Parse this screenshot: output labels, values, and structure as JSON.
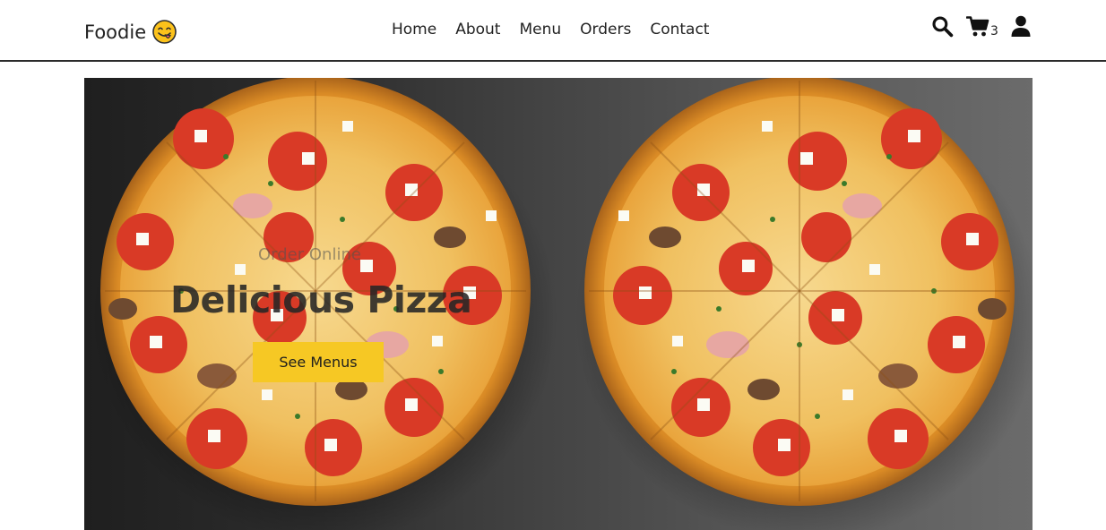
{
  "brand": {
    "name": "Foodie",
    "emoji_icon": "face-savoring-food-icon"
  },
  "nav": {
    "links": [
      {
        "label": "Home"
      },
      {
        "label": "About"
      },
      {
        "label": "Menu"
      },
      {
        "label": "Orders"
      },
      {
        "label": "Contact"
      }
    ]
  },
  "header_icons": {
    "search_icon": "search-icon",
    "cart_icon": "cart-icon",
    "cart_count": "3",
    "user_icon": "user-icon"
  },
  "hero": {
    "subtitle": "Order Online",
    "title": "Delicious Pizza",
    "cta_label": "See Menus",
    "images": [
      "pizza-image",
      "pizza-image"
    ]
  },
  "colors": {
    "accent": "#f6c824",
    "text": "#222222",
    "hero_bg_start": "#1f1f1f",
    "hero_bg_end": "#6b6b6b"
  }
}
